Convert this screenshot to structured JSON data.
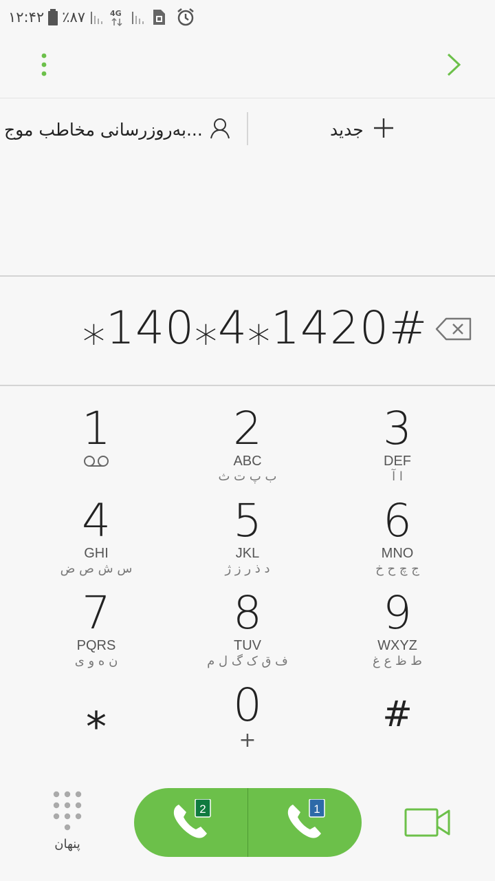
{
  "status_bar": {
    "time": "۱۲:۴۲",
    "battery": "٪۸۷",
    "network": "4G"
  },
  "topbar": {
    "more_icon": "more-vertical-icon",
    "next_icon": "chevron-right-icon"
  },
  "actions": {
    "new_label": "جدید",
    "update_label": "به‌روزرسانی مخاطب موج..."
  },
  "display": {
    "number": "⁎140⁎4⁎1420#"
  },
  "keypad": {
    "keys": [
      {
        "digit": "1",
        "latin": "",
        "farsi": ""
      },
      {
        "digit": "2",
        "latin": "ABC",
        "farsi": "ب پ ت ث"
      },
      {
        "digit": "3",
        "latin": "DEF",
        "farsi": "ا آ"
      },
      {
        "digit": "4",
        "latin": "GHI",
        "farsi": "س ش ص ض"
      },
      {
        "digit": "5",
        "latin": "JKL",
        "farsi": "د ذ ر ز ژ"
      },
      {
        "digit": "6",
        "latin": "MNO",
        "farsi": "ج چ ح خ"
      },
      {
        "digit": "7",
        "latin": "PQRS",
        "farsi": "ن ه و ی"
      },
      {
        "digit": "8",
        "latin": "TUV",
        "farsi": "ف ق ک گ ل م"
      },
      {
        "digit": "9",
        "latin": "WXYZ",
        "farsi": "ط ظ ع غ"
      }
    ],
    "star": "⁎",
    "zero": "0",
    "plus": "+",
    "hash": "#"
  },
  "bottom": {
    "hide_label": "پنهان",
    "sim2_badge": "2",
    "sim1_badge": "1"
  },
  "colors": {
    "accent": "#6cc04a",
    "accent_dark": "#4e9a33",
    "sim2_badge": "#0f7a3f",
    "sim1_badge": "#2d6aa8"
  }
}
